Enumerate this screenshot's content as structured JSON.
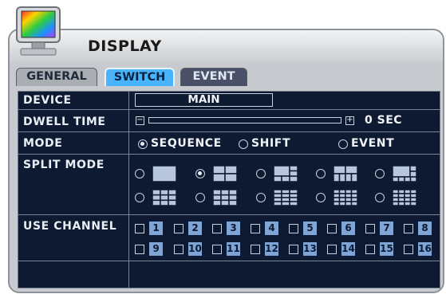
{
  "window": {
    "title": "DISPLAY"
  },
  "tabs": [
    {
      "label": "GENERAL",
      "active": false
    },
    {
      "label": "SWITCH",
      "active": true
    },
    {
      "label": "EVENT",
      "active": false
    }
  ],
  "colors": {
    "active_tab": "#48b4ff",
    "panel_bg": "#0d1a31",
    "window_bg": "#c7cbcf",
    "channel_badge": "#7fa4d6"
  },
  "rows": {
    "device": {
      "label": "DEVICE",
      "value": "MAIN"
    },
    "dwell": {
      "label": "DWELL TIME",
      "value": "0 SEC",
      "minus": "−",
      "plus": "+"
    },
    "mode": {
      "label": "MODE",
      "options": [
        "SEQUENCE",
        "SHIFT",
        "EVENT"
      ],
      "selected": "SEQUENCE"
    },
    "split": {
      "label": "SPLIT MODE",
      "selected_index": 1,
      "layouts": [
        "single",
        "quad",
        "six",
        "eight",
        "nine-alt",
        "nine",
        "ten",
        "thirteen",
        "sixteen",
        "grid-16"
      ]
    },
    "channels": {
      "label": "USE CHANNEL",
      "items": [
        "1",
        "2",
        "3",
        "4",
        "5",
        "6",
        "7",
        "8",
        "9",
        "10",
        "11",
        "12",
        "13",
        "14",
        "15",
        "16"
      ],
      "checked": []
    }
  }
}
